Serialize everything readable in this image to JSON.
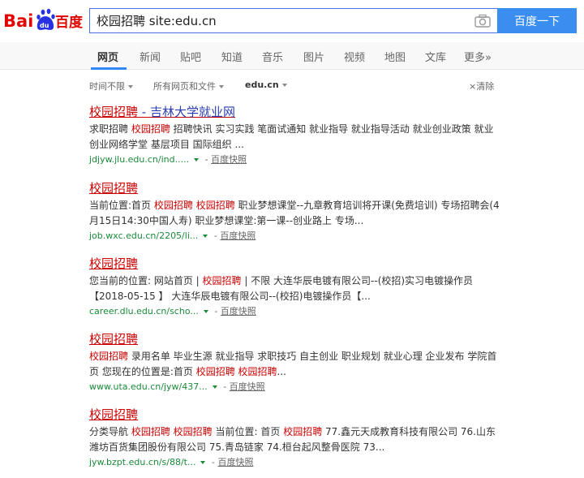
{
  "header": {
    "logo_text": "Bai百度",
    "search_value": "校园招聘 site:edu.cn",
    "search_button": "百度一下"
  },
  "nav": {
    "tabs": [
      "网页",
      "新闻",
      "贴吧",
      "知道",
      "音乐",
      "图片",
      "视频",
      "地图",
      "文库",
      "更多»"
    ]
  },
  "filters": {
    "time": "时间不限",
    "type": "所有网页和文件",
    "site": "edu.cn",
    "clear": "清除"
  },
  "results": [
    {
      "title_highlight": "校园招聘",
      "title_rest": " - 吉林大学就业网",
      "snippet": [
        {
          "t": "求职招聘 "
        },
        {
          "t": "校园招聘",
          "em": true
        },
        {
          "t": " 招聘快讯 实习实践 笔面试通知 就业指导 就业指导活动 就业创业政策 就业创业网络学堂 基层项目 国际组织 ..."
        }
      ],
      "url": "jdjyw.jlu.edu.cn/ind.....",
      "cache": "百度快照"
    },
    {
      "title_highlight": "校园招聘",
      "title_rest": "",
      "snippet": [
        {
          "t": "当前位置:首页 "
        },
        {
          "t": "校园招聘",
          "em": true
        },
        {
          "t": " "
        },
        {
          "t": "校园招聘",
          "em": true
        },
        {
          "t": " 职业梦想课堂--九章教育培训将开课(免费培训) 专场招聘会(4月15日14:30中国人寿) 职业梦想课堂:第一课--创业路上 专场..."
        }
      ],
      "url": "job.wxc.edu.cn/2205/li...",
      "cache": "百度快照"
    },
    {
      "title_highlight": "校园招聘",
      "title_rest": "",
      "snippet": [
        {
          "t": "您当前的位置: 网站首页 | "
        },
        {
          "t": "校园招聘",
          "em": true
        },
        {
          "t": " | 不限 大连华辰电镀有限公司--(校招)实习电镀操作员 【2018-05-15 】 大连华辰电镀有限公司--(校招)电镀操作员【..."
        }
      ],
      "url": "career.dlu.edu.cn/scho...",
      "cache": "百度快照"
    },
    {
      "title_highlight": "校园招聘",
      "title_rest": "",
      "snippet": [
        {
          "t": "校园招聘",
          "em": true
        },
        {
          "t": " 录用名单 毕业生源 就业指导 求职技巧 自主创业 职业规划 就业心理 企业发布 学院首页 您现在的位置是:首页 "
        },
        {
          "t": "校园招聘",
          "em": true
        },
        {
          "t": " "
        },
        {
          "t": "校园招聘",
          "em": true
        },
        {
          "t": "..."
        }
      ],
      "url": "www.uta.edu.cn/jyw/437...",
      "cache": "百度快照"
    },
    {
      "title_highlight": "校园招聘",
      "title_rest": "",
      "snippet": [
        {
          "t": "分类导航 "
        },
        {
          "t": "校园招聘",
          "em": true
        },
        {
          "t": " "
        },
        {
          "t": "校园招聘",
          "em": true
        },
        {
          "t": " 当前位置: 首页 "
        },
        {
          "t": "校园招聘",
          "em": true
        },
        {
          "t": " 77.鑫元天成教育科技有限公司 76.山东潍坊百货集团股份有限公司 75.青岛链家 74.桓台起风整骨医院 73..."
        }
      ],
      "url": "jyw.bzpt.edu.cn/s/88/t...",
      "cache": "百度快照"
    }
  ]
}
